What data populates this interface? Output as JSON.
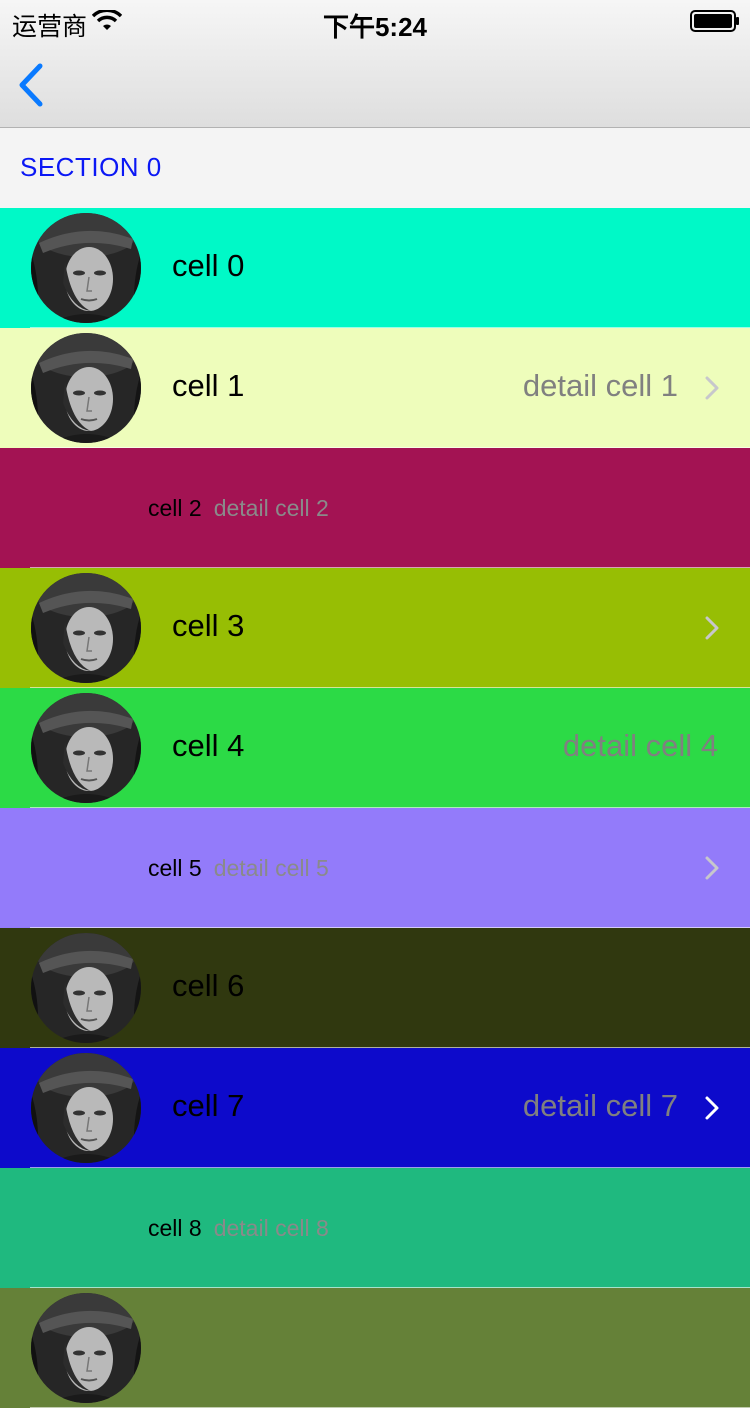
{
  "status": {
    "carrier": "运营商",
    "time": "下午5:24"
  },
  "nav": {
    "back_icon": "chevron-left-icon"
  },
  "section": {
    "title": "SECTION 0"
  },
  "cells": [
    {
      "title": "cell 0",
      "detail": "",
      "style": "default",
      "bg": "#00f9c7",
      "accessory": "none"
    },
    {
      "title": "cell 1",
      "detail": "detail cell 1",
      "style": "value1",
      "bg": "#eefdbb",
      "accessory": "disclosure"
    },
    {
      "title": "cell 2",
      "detail": "detail cell 2",
      "style": "value2",
      "bg": "#a31353",
      "accessory": "none"
    },
    {
      "title": "cell 3",
      "detail": "",
      "style": "default",
      "bg": "#97be04",
      "accessory": "disclosure"
    },
    {
      "title": "cell 4",
      "detail": "detail cell 4",
      "style": "value1",
      "bg": "#2cda46",
      "accessory": "none"
    },
    {
      "title": "cell 5",
      "detail": "detail cell 5",
      "style": "value2",
      "bg": "#937bfa",
      "accessory": "disclosure"
    },
    {
      "title": "cell 6",
      "detail": "",
      "style": "default",
      "bg": "#30380f",
      "accessory": "none"
    },
    {
      "title": "cell 7",
      "detail": "detail cell 7",
      "style": "value1",
      "bg": "#0d0acb",
      "accessory": "disclosure"
    },
    {
      "title": "cell 8",
      "detail": "detail cell 8",
      "style": "value2",
      "bg": "#1fb97f",
      "accessory": "none"
    },
    {
      "title": "",
      "detail": "",
      "style": "default",
      "bg": "#658138",
      "accessory": "none"
    }
  ]
}
